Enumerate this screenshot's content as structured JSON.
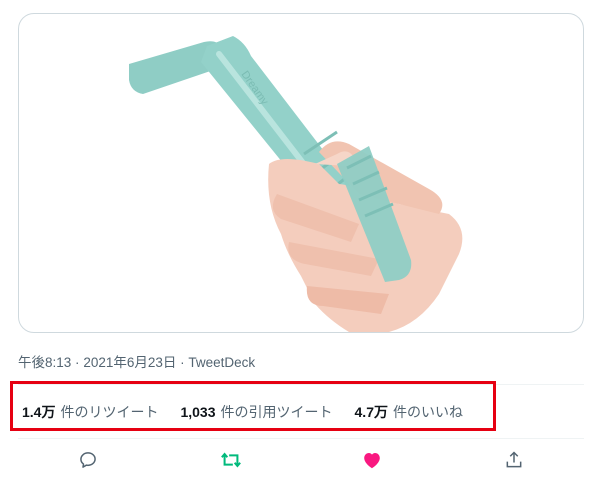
{
  "media": {
    "image_alt": "mint green silicone straw held in a hand",
    "image_text": "Dreamy"
  },
  "meta": {
    "time": "午後8:13",
    "sep1": "·",
    "date": "2021年6月23日",
    "sep2": "·",
    "source": "TweetDeck"
  },
  "stats": {
    "retweets_count": "1.4万",
    "retweets_label": "件のリツイート",
    "quotes_count": "1,033",
    "quotes_label": "件の引用ツイート",
    "likes_count": "4.7万",
    "likes_label": "件のいいね"
  },
  "actions": {
    "reply_icon": "reply-icon",
    "retweet_icon": "retweet-icon",
    "like_icon": "heart-icon",
    "share_icon": "share-icon"
  },
  "colors": {
    "highlight_border": "#e60012",
    "retweet_green": "#00ba7c",
    "like_pink": "#f91880",
    "icon_gray": "#536471",
    "straw": "#8fcdc5"
  }
}
